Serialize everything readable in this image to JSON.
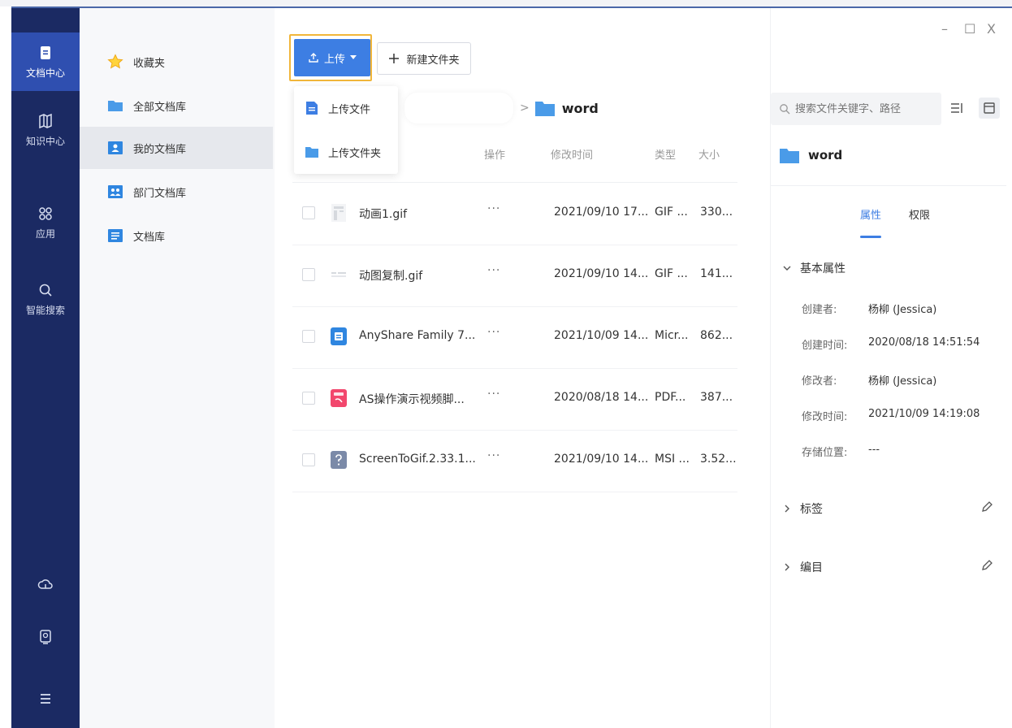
{
  "window": {
    "minimize": "–",
    "maximize": "☐",
    "close": "X"
  },
  "nav": {
    "items": [
      {
        "label": "文档中心",
        "icon": "document-icon",
        "active": true
      },
      {
        "label": "知识中心",
        "icon": "map-icon",
        "active": false
      },
      {
        "label": "应用",
        "icon": "apps-icon",
        "active": false
      },
      {
        "label": "智能搜索",
        "icon": "search-icon",
        "active": false
      }
    ],
    "bottom_icons": [
      "cloud-icon",
      "device-icon",
      "menu-icon"
    ]
  },
  "libraries": {
    "items": [
      {
        "label": "收藏夹",
        "icon": "star-icon",
        "active": false
      },
      {
        "label": "全部文档库",
        "icon": "folder-icon",
        "active": false
      },
      {
        "label": "我的文档库",
        "icon": "user-library-icon",
        "active": true
      },
      {
        "label": "部门文档库",
        "icon": "department-library-icon",
        "active": false
      },
      {
        "label": "文档库",
        "icon": "library-icon",
        "active": false
      }
    ]
  },
  "toolbar": {
    "upload_label": "上传",
    "new_folder_label": "新建文件夹"
  },
  "upload_menu": {
    "items": [
      {
        "label": "上传文件",
        "icon": "file-icon"
      },
      {
        "label": "上传文件夹",
        "icon": "folder-icon"
      }
    ]
  },
  "breadcrumb": {
    "separator": ">",
    "current": "word"
  },
  "table": {
    "headers": {
      "ops": "操作",
      "mtime": "修改时间",
      "type": "类型",
      "size": "大小"
    },
    "ops_label": "···",
    "rows": [
      {
        "name": "动画1.gif",
        "mtime": "2021/09/10 17...",
        "type": "GIF ...",
        "size": "330...",
        "icon": "gif-file-icon"
      },
      {
        "name": "动图复制.gif",
        "mtime": "2021/09/10 14...",
        "type": "GIF ...",
        "size": "141...",
        "icon": "gif-file-icon"
      },
      {
        "name": "AnyShare Family 7...",
        "mtime": "2021/10/09 14...",
        "type": "Micr...",
        "size": "862...",
        "icon": "word-file-icon"
      },
      {
        "name": "AS操作演示视频脚...",
        "mtime": "2020/08/18 14...",
        "type": "PDF...",
        "size": "387...",
        "icon": "pdf-file-icon"
      },
      {
        "name": "ScreenToGif.2.33.1...",
        "mtime": "2021/09/10 14...",
        "type": "MSI ...",
        "size": "3.52...",
        "icon": "unknown-file-icon"
      }
    ]
  },
  "details": {
    "search_placeholder": "搜索文件关键字、路径",
    "folder_name": "word",
    "tabs": [
      {
        "label": "属性",
        "active": true
      },
      {
        "label": "权限",
        "active": false
      }
    ],
    "basic_section": "基本属性",
    "props": [
      {
        "label": "创建者:",
        "value": "杨柳 (Jessica)"
      },
      {
        "label": "创建时间:",
        "value": "2020/08/18 14:51:54"
      },
      {
        "label": "修改者:",
        "value": "杨柳 (Jessica)"
      },
      {
        "label": "修改时间:",
        "value": "2021/10/09 14:19:08"
      },
      {
        "label": "存储位置:",
        "value": "---"
      }
    ],
    "tags_section": "标签",
    "catalog_section": "编目"
  },
  "colors": {
    "nav_bg": "#1b2a63",
    "nav_active": "#2f4fb0",
    "accent": "#3d7ee3",
    "highlight_border": "#f1b63a",
    "folder": "#4a9be8"
  }
}
